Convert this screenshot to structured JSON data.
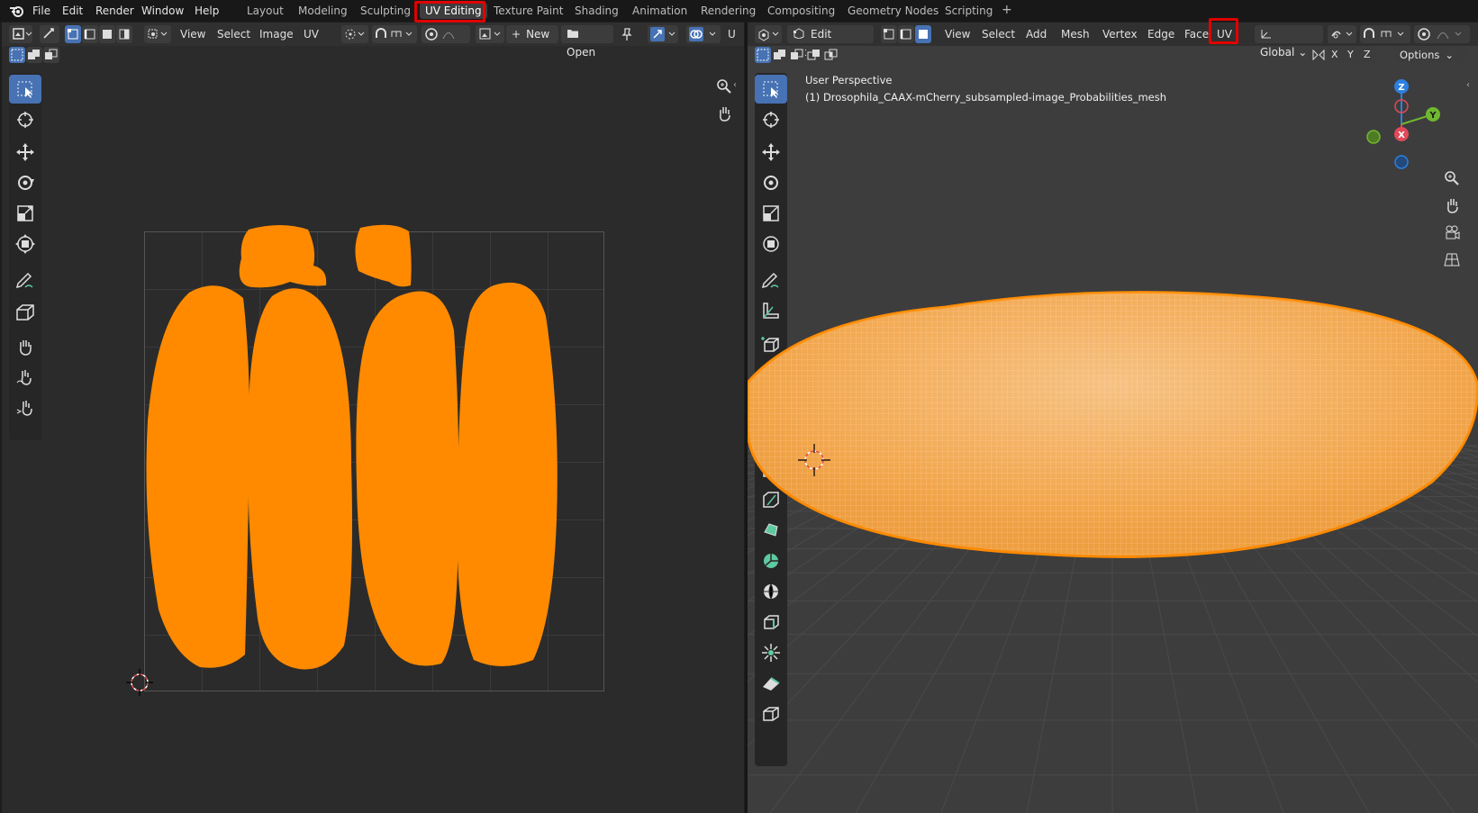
{
  "menu": {
    "file": "File",
    "edit": "Edit",
    "render": "Render",
    "window": "Window",
    "help": "Help"
  },
  "workspaces": [
    "Layout",
    "Modeling",
    "Sculpting",
    "UV Editing",
    "Texture Paint",
    "Shading",
    "Animation",
    "Rendering",
    "Compositing",
    "Geometry Nodes",
    "Scripting"
  ],
  "workspace_add": "+",
  "active_workspace": "UV Editing",
  "uv_editor": {
    "menus": [
      "View",
      "Select",
      "Image",
      "UV"
    ],
    "new_label": "New",
    "open_label": "Open",
    "new_prefix": "+",
    "trailing": "U"
  },
  "viewport": {
    "mode": "Edit Mode",
    "menus": [
      "View",
      "Select",
      "Add",
      "Mesh",
      "Vertex",
      "Edge",
      "Face",
      "UV"
    ],
    "orientation": "Global",
    "axis_x": "X",
    "axis_y": "Y",
    "axis_z": "Z",
    "options_label": "Options",
    "view_name": "User Perspective",
    "object_name": "(1) Drosophila_CAAX-mCherry_subsampled-image_Probabilities_mesh",
    "gizmo": {
      "x": "X",
      "y": "Y",
      "z": "Z"
    }
  },
  "colors": {
    "accent": "#4772b3",
    "mesh": "#ff8a00",
    "highlight": "#e00000"
  },
  "icons": {
    "uv_tools": [
      "select-box-icon",
      "cursor-icon",
      "move-icon",
      "rotate-icon",
      "scale-icon",
      "transform-icon",
      "annotate-icon",
      "rip-region-icon",
      "grab-icon",
      "relax-icon",
      "pinch-icon"
    ],
    "vp_tools": [
      "select-box-icon",
      "cursor-icon",
      "move-icon",
      "rotate-icon",
      "scale-icon",
      "transform-icon",
      "annotate-icon",
      "measure-icon",
      "add-cube-icon",
      "extrude-icon",
      "inset-icon",
      "bevel-icon",
      "loop-cut-icon",
      "knife-icon",
      "poly-build-icon",
      "spin-icon",
      "smooth-icon",
      "edge-slide-icon",
      "shrink-fatten-icon",
      "shear-icon",
      "rip-icon"
    ]
  }
}
